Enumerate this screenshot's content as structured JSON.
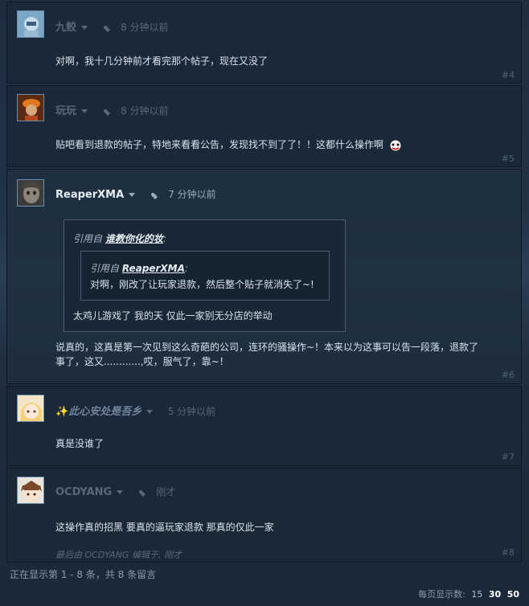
{
  "posts": [
    {
      "author": "九鲛",
      "time": "8 分钟以前",
      "text": "对啊，我十几分钟前才看完那个帖子，现在又没了",
      "num": "#4"
    },
    {
      "author": "玩玩",
      "time": "8 分钟以前",
      "text": "贴吧看到退款的帖子，特地来看看公告，发现找不到了了！！这都什么操作啊",
      "num": "#5"
    },
    {
      "author": "ReaperXMA",
      "time": "7 分钟以前",
      "quote_prefix": "引用自",
      "quote_author": "谁教你化的妆",
      "quote_colon": ":",
      "inner_prefix": "引用自",
      "inner_author": "ReaperXMA",
      "inner_colon": ":",
      "inner_text": "对啊，刚改了让玩家退款，然后整个贴子就消失了~!",
      "quote_text": "太鸡儿游戏了 我的天 仅此一家别无分店的举动",
      "text_line1": "说真的，这真是第一次见到这么奇葩的公司，连环的骚操作~！本来以为这事可以告一段落，退款了",
      "text_line2": "事了，这又............,哎，服气了，靠~！",
      "num": "#6"
    },
    {
      "author_prefix": "✨",
      "author": "此心安处是吾乡",
      "time": "5 分钟以前",
      "text": "真是没谁了",
      "num": "#7"
    },
    {
      "author": "OCDYANG",
      "time": "刚才",
      "text": "这操作真的招黑 要真的逼玩家退款 那真的仅此一家",
      "edited": "最后由 OCDYANG 编辑于, 刚才",
      "num": "#8"
    }
  ],
  "footer": {
    "info": "正在显示第 1 - 8 条，共 8 条留言",
    "perpage_label": "每页显示数:",
    "options": [
      "15",
      "30",
      "50"
    ]
  },
  "colors": {
    "background": "#1b2838",
    "name_dim": "#56687a",
    "name_bright": "#e6eef5",
    "text": "#d8e2ea"
  }
}
